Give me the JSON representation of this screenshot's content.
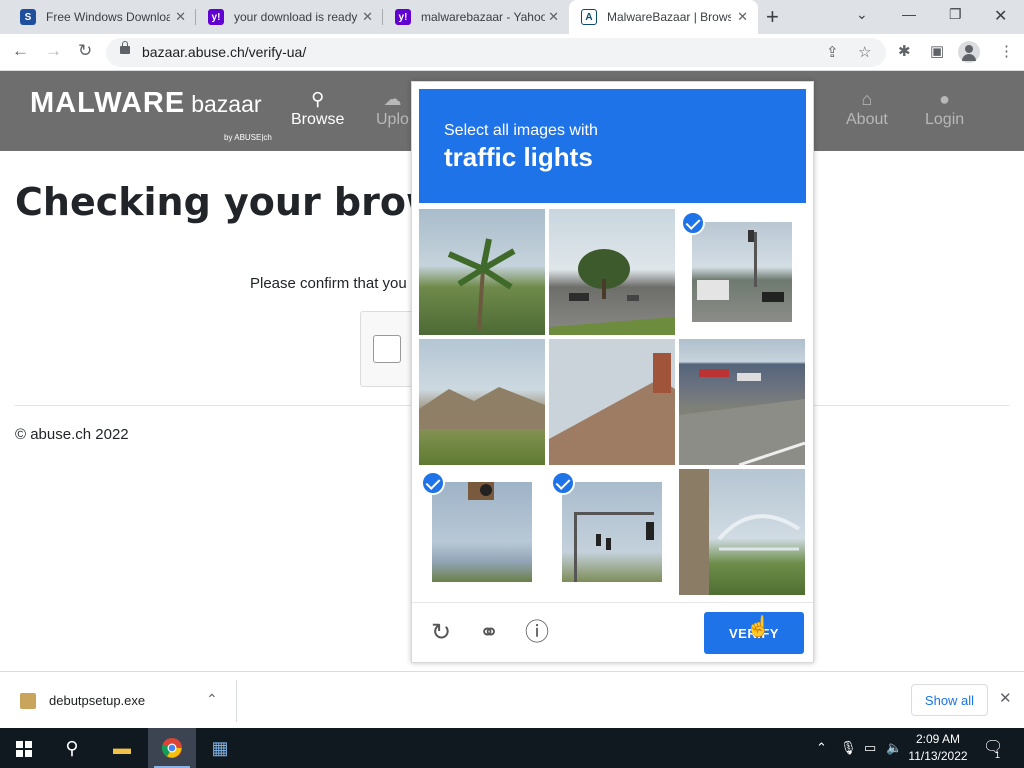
{
  "browser": {
    "tabs": [
      {
        "title": "Free Windows Downloads",
        "icon": "S"
      },
      {
        "title": "your download is ready",
        "icon": "y!"
      },
      {
        "title": "malwarebazaar - Yahoo",
        "icon": "y!"
      },
      {
        "title": "MalwareBazaar | Browse",
        "icon": "A"
      }
    ],
    "url": "bazaar.abuse.ch/verify-ua/"
  },
  "site": {
    "logo_main": "MALWARE",
    "logo_sub": "bazaar",
    "logo_by": "by ABUSE|ch",
    "nav": [
      {
        "label": "Browse",
        "icon": "search-icon"
      },
      {
        "label": "Uplo",
        "icon": "upload-icon"
      },
      {
        "label": "About",
        "icon": "bank-icon"
      },
      {
        "label": "Login",
        "icon": "user-icon"
      }
    ]
  },
  "page": {
    "heading": "Checking your browse",
    "confirm_text": "Please confirm that you",
    "footer": "© abuse.ch 2022"
  },
  "captcha": {
    "prompt_line1": "Select all images with",
    "prompt_line2": "traffic lights",
    "tiles": [
      {
        "subject": "palm tree",
        "selected": false
      },
      {
        "subject": "road with tree and parked cars",
        "selected": false
      },
      {
        "subject": "intersection with truck and traffic light",
        "selected": true
      },
      {
        "subject": "mountains and field",
        "selected": false
      },
      {
        "subject": "shingled roof",
        "selected": false
      },
      {
        "subject": "road and storefronts",
        "selected": false
      },
      {
        "subject": "sky with object",
        "selected": true
      },
      {
        "subject": "traffic lights on pole",
        "selected": true
      },
      {
        "subject": "tree trunk and bridge",
        "selected": false
      }
    ],
    "verify_label": "VERIFY",
    "accent": "#1e73e8"
  },
  "downloads": {
    "filename": "debutpsetup.exe",
    "show_all": "Show all"
  },
  "taskbar": {
    "time": "2:09 AM",
    "date": "11/13/2022",
    "notification_count": "1"
  }
}
